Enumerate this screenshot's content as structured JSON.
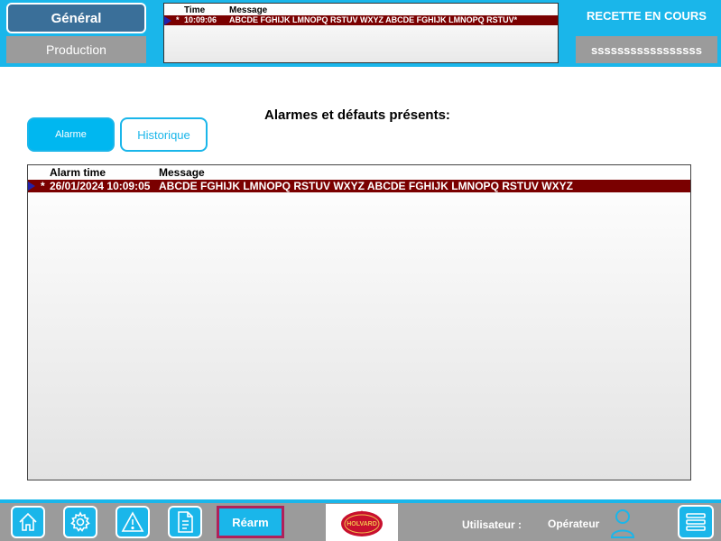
{
  "header": {
    "general_label": "Général",
    "production_label": "Production",
    "recipe_title": "RECETTE EN COURS",
    "recipe_value": "sssssssssssssssss"
  },
  "mini_alarm": {
    "col_time": "Time",
    "col_message": "Message",
    "row": {
      "marker": "*",
      "time": "10:09:06",
      "message": "ABCDE FGHIJK LMNOPQ RSTUV WXYZ ABCDE FGHIJK LMNOPQ RSTUV*"
    }
  },
  "main": {
    "title": "Alarmes et défauts présents:",
    "tabs": [
      {
        "label": "Alarme"
      },
      {
        "label": "Historique"
      }
    ],
    "table": {
      "col_alarm_time": "Alarm time",
      "col_message": "Message",
      "rows": [
        {
          "marker": "*",
          "time": "26/01/2024 10:09:05",
          "message": "ABCDE FGHIJK LMNOPQ RSTUV WXYZ ABCDE FGHIJK LMNOPQ RSTUV WXYZ"
        }
      ]
    }
  },
  "footer": {
    "icons": [
      "home-icon",
      "settings-icon",
      "warning-icon",
      "document-icon",
      "menu-icon",
      "user-icon"
    ],
    "rearm_label": "Réarm",
    "logo_text": "HOLVARD",
    "user_label": "Utilisateur :",
    "user_value": "Opérateur"
  },
  "colors": {
    "accent": "#1ab6ea",
    "alarm_row": "#7a0000",
    "general_button": "#3a6f99",
    "grey_button": "#9b9b9b",
    "rearm_border": "#b0205a"
  }
}
